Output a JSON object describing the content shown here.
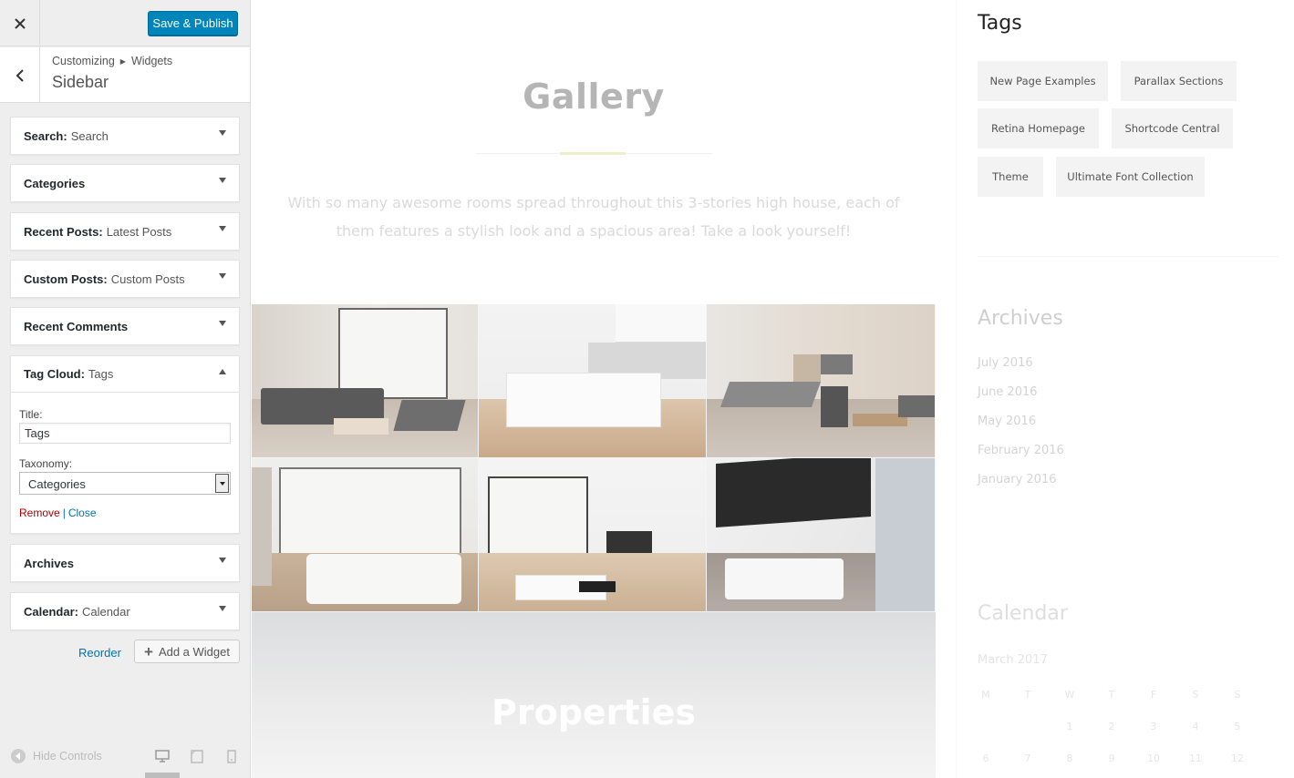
{
  "panel": {
    "publish_label": "Save & Publish",
    "breadcrumb": {
      "root": "Customizing",
      "section": "Widgets"
    },
    "section_title": "Sidebar",
    "widgets": [
      {
        "name": "Search:",
        "title": "Search"
      },
      {
        "name": "Categories",
        "title": ""
      },
      {
        "name": "Recent Posts:",
        "title": "Latest Posts"
      },
      {
        "name": "Custom Posts:",
        "title": "Custom Posts"
      },
      {
        "name": "Recent Comments",
        "title": ""
      },
      {
        "name": "Tag Cloud:",
        "title": "Tags"
      },
      {
        "name": "Archives",
        "title": ""
      },
      {
        "name": "Calendar:",
        "title": "Calendar"
      }
    ],
    "tag_cloud_form": {
      "title_label": "Title:",
      "title_value": "Tags",
      "taxonomy_label": "Taxonomy:",
      "taxonomy_value": "Categories",
      "remove_label": "Remove",
      "separator": "|",
      "close_label": "Close"
    },
    "reorder_label": "Reorder",
    "add_widget_label": "Add a Widget",
    "hide_controls_label": "Hide Controls"
  },
  "preview": {
    "gallery_title": "Gallery",
    "gallery_text": "With so many awesome rooms spread throughout this 3-stories high house, each of them features a stylish look and a spacious area! Take a look yourself!",
    "properties_title": "Properties",
    "tags_heading": "Tags",
    "tags": [
      "New Page Examples",
      "Parallax Sections",
      "Retina Homepage",
      "Shortcode Central",
      "Theme",
      "Ultimate Font Collection"
    ],
    "archives_heading": "Archives",
    "archives": [
      "July 2016",
      "June 2016",
      "May 2016",
      "February 2016",
      "January 2016"
    ],
    "calendar_heading": "Calendar",
    "calendar_caption": "March 2017",
    "calendar_days": [
      "M",
      "T",
      "W",
      "T",
      "F",
      "S",
      "S"
    ],
    "calendar_row1": [
      "",
      "",
      "1",
      "2",
      "3",
      "4",
      "5"
    ],
    "calendar_row2": [
      "6",
      "7",
      "8",
      "9",
      "10",
      "11",
      "12"
    ]
  },
  "colors": {
    "publish_button": "#0085ba",
    "link": "#0073aa",
    "remove_link": "#aa0000"
  }
}
